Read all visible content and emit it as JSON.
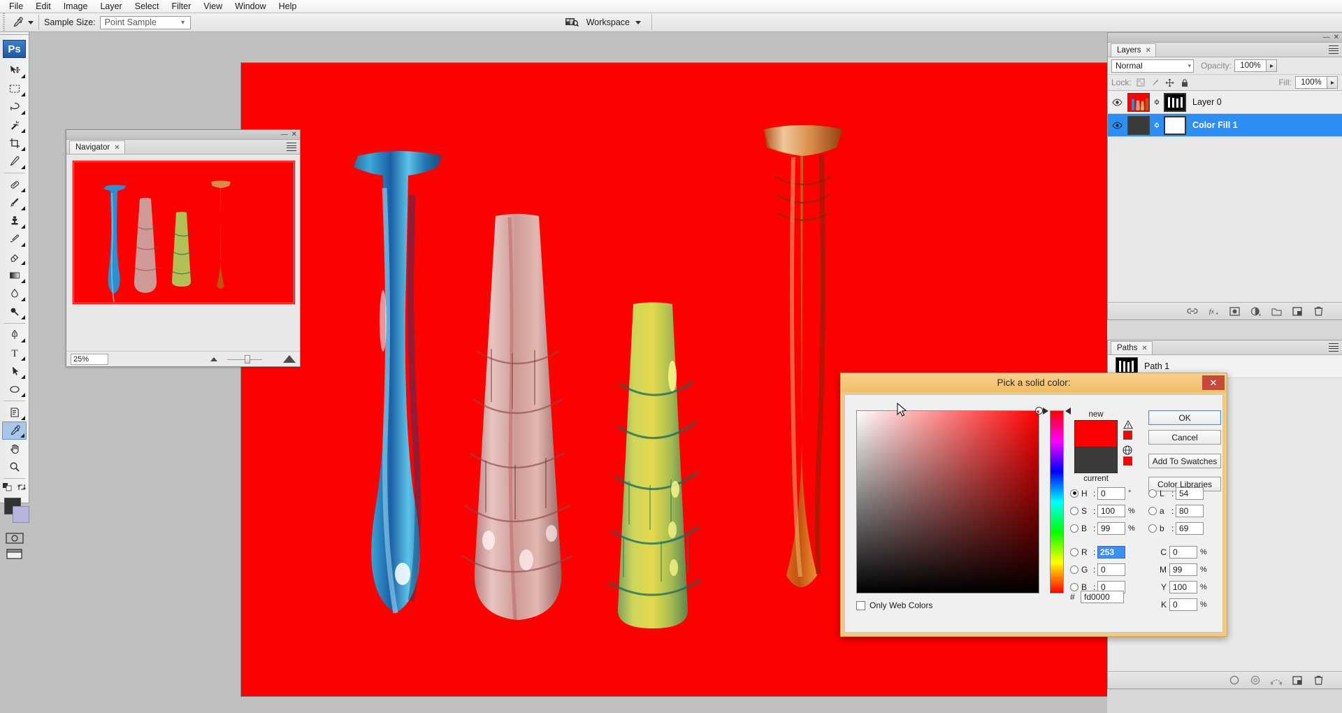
{
  "app": {
    "name": "Adobe Photoshop",
    "logo_text": "Ps"
  },
  "menubar": {
    "items": [
      {
        "label": "File"
      },
      {
        "label": "Edit"
      },
      {
        "label": "Image"
      },
      {
        "label": "Layer"
      },
      {
        "label": "Select"
      },
      {
        "label": "Filter"
      },
      {
        "label": "View"
      },
      {
        "label": "Window"
      },
      {
        "label": "Help"
      }
    ]
  },
  "optionsbar": {
    "active_tool_icon": "eyedropper-icon",
    "sample_size_label": "Sample Size:",
    "sample_size_value": "Point Sample",
    "workspace_label": "Workspace",
    "workspace_icon": "workspace-switcher-icon"
  },
  "toolbox": {
    "tools": [
      {
        "name": "move-tool",
        "icon": "move-icon",
        "selected": false
      },
      {
        "name": "rectangular-marquee-tool",
        "icon": "marquee-icon",
        "selected": false
      },
      {
        "name": "lasso-tool",
        "icon": "lasso-icon",
        "selected": false
      },
      {
        "name": "magic-wand-tool",
        "icon": "magic-wand-icon",
        "selected": false
      },
      {
        "name": "crop-tool",
        "icon": "crop-icon",
        "selected": false
      },
      {
        "name": "slice-tool",
        "icon": "slice-icon",
        "selected": false
      },
      {
        "name": "spot-healing-tool",
        "icon": "healing-brush-icon",
        "selected": false
      },
      {
        "name": "brush-tool",
        "icon": "brush-icon",
        "selected": false
      },
      {
        "name": "clone-stamp-tool",
        "icon": "clone-stamp-icon",
        "selected": false
      },
      {
        "name": "history-brush-tool",
        "icon": "history-brush-icon",
        "selected": false
      },
      {
        "name": "eraser-tool",
        "icon": "eraser-icon",
        "selected": false
      },
      {
        "name": "gradient-tool",
        "icon": "gradient-icon",
        "selected": false
      },
      {
        "name": "blur-tool",
        "icon": "blur-drop-icon",
        "selected": false
      },
      {
        "name": "dodge-tool",
        "icon": "dodge-icon",
        "selected": false
      },
      {
        "name": "pen-tool",
        "icon": "pen-icon",
        "selected": false
      },
      {
        "name": "type-tool",
        "icon": "type-t-icon",
        "selected": false
      },
      {
        "name": "path-selection-tool",
        "icon": "path-arrow-icon",
        "selected": false
      },
      {
        "name": "ellipse-shape-tool",
        "icon": "ellipse-icon",
        "selected": false
      },
      {
        "name": "notes-tool",
        "icon": "notes-icon",
        "selected": false
      },
      {
        "name": "eyedropper-tool",
        "icon": "eyedropper-icon",
        "selected": true
      },
      {
        "name": "hand-tool",
        "icon": "hand-icon",
        "selected": false
      },
      {
        "name": "zoom-tool",
        "icon": "magnifier-icon",
        "selected": false
      }
    ],
    "foreground_color": "#333333",
    "background_color": "#b4b4dc",
    "quick_mask_icon": "quick-mask-icon",
    "screen_mode_icon": "screen-mode-icon"
  },
  "navigator": {
    "tab_label": "Navigator",
    "zoom_percent": "25%",
    "canvas_color": "#fd0000",
    "minimize_icon": "minimize-icon",
    "close_icon": "close-icon",
    "menu_icon": "panel-menu-icon"
  },
  "document": {
    "background_color": "#fd0000",
    "vases": [
      {
        "name": "blue-vase",
        "color": "#2b8fd0"
      },
      {
        "name": "pink-vase",
        "color": "#d9a3a0"
      },
      {
        "name": "green-vase",
        "color": "#b3c055"
      },
      {
        "name": "orange-vase",
        "color": "#d4691d"
      }
    ]
  },
  "layers_panel": {
    "tab_label": "Layers",
    "blend_mode": "Normal",
    "opacity_label": "Opacity:",
    "opacity_value": "100%",
    "lock_label": "Lock:",
    "fill_label": "Fill:",
    "fill_value": "100%",
    "lock_icons": [
      "lock-transparent-icon",
      "lock-image-icon",
      "lock-position-icon",
      "lock-all-icon"
    ],
    "rows": [
      {
        "name": "Layer 0",
        "selected": false,
        "visible": true,
        "has_mask": true
      },
      {
        "name": "Color Fill 1",
        "selected": true,
        "visible": true,
        "has_mask": true
      }
    ],
    "bottom_icons": [
      "link-layers-icon",
      "layer-style-fx-icon",
      "add-mask-icon",
      "adjustment-layer-icon",
      "new-group-icon",
      "new-layer-icon",
      "delete-layer-icon"
    ]
  },
  "paths_panel": {
    "tab_label": "Paths",
    "rows": [
      {
        "name": "Path 1"
      }
    ],
    "bottom_icons": [
      "fill-path-icon",
      "stroke-path-icon",
      "path-to-selection-icon",
      "new-path-icon",
      "delete-path-icon"
    ]
  },
  "color_picker": {
    "title": "Pick a solid color:",
    "close_icon": "close-icon",
    "new_label": "new",
    "current_label": "current",
    "new_color": "#fd0000",
    "current_color": "#3b3b3b",
    "out_of_gamut_icon": "gamut-warning-icon",
    "out_of_gamut_swatch": "#fd0000",
    "web_safe_icon": "web-safe-warning-icon",
    "web_safe_swatch": "#ff0000",
    "buttons": [
      {
        "label": "OK",
        "primary": true
      },
      {
        "label": "Cancel",
        "primary": false
      },
      {
        "label": "Add To Swatches",
        "primary": false
      },
      {
        "label": "Color Libraries",
        "primary": false
      }
    ],
    "hsb": [
      {
        "key": "H",
        "value": "0",
        "unit": "°",
        "selected": true
      },
      {
        "key": "S",
        "value": "100",
        "unit": "%",
        "selected": false
      },
      {
        "key": "B",
        "value": "99",
        "unit": "%",
        "selected": false
      }
    ],
    "lab": [
      {
        "key": "L",
        "value": "54",
        "unit": "",
        "selected": false
      },
      {
        "key": "a",
        "value": "80",
        "unit": "",
        "selected": false
      },
      {
        "key": "b",
        "value": "69",
        "unit": "",
        "selected": false
      }
    ],
    "rgb": [
      {
        "key": "R",
        "value": "253",
        "unit": "",
        "selected": false,
        "highlight": true
      },
      {
        "key": "G",
        "value": "0",
        "unit": "",
        "selected": false,
        "highlight": false
      },
      {
        "key": "B",
        "value": "0",
        "unit": "",
        "selected": false,
        "highlight": false
      }
    ],
    "cmyk": [
      {
        "key": "C",
        "value": "0",
        "unit": "%"
      },
      {
        "key": "M",
        "value": "99",
        "unit": "%"
      },
      {
        "key": "Y",
        "value": "100",
        "unit": "%"
      },
      {
        "key": "K",
        "value": "0",
        "unit": "%"
      }
    ],
    "only_web_colors_label": "Only Web Colors",
    "only_web_colors_checked": false,
    "hex_symbol": "#",
    "hex_value": "fd0000"
  }
}
